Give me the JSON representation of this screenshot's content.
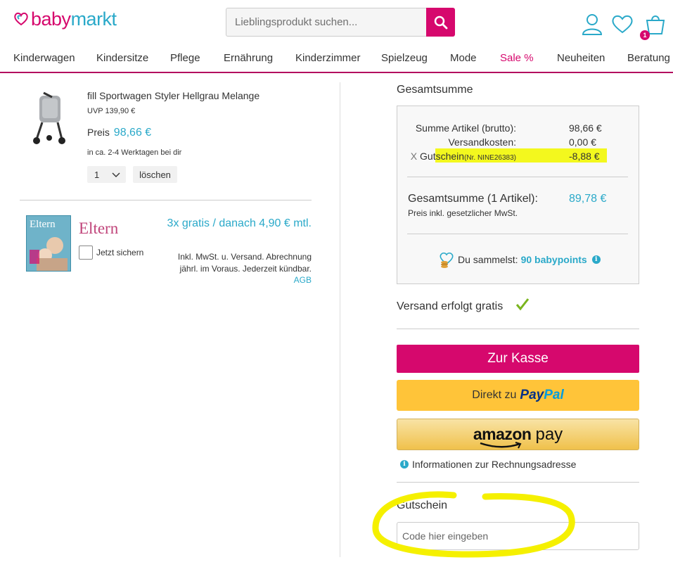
{
  "header": {
    "logo": {
      "part1": "baby",
      "part2": "markt"
    },
    "search_placeholder": "Lieblingsprodukt suchen...",
    "cart_count": "1"
  },
  "nav": [
    {
      "label": "Kinderwagen"
    },
    {
      "label": "Kindersitze"
    },
    {
      "label": "Pflege"
    },
    {
      "label": "Ernährung"
    },
    {
      "label": "Kinderzimmer"
    },
    {
      "label": "Spielzeug"
    },
    {
      "label": "Mode"
    },
    {
      "label": "Sale %"
    },
    {
      "label": "Neuheiten"
    },
    {
      "label": "Beratung"
    }
  ],
  "product": {
    "name": "fill Sportwagen Styler Hellgrau Melange",
    "uvp": "UVP 139,90 €",
    "price_label": "Preis",
    "price": "98,66 €",
    "delivery": "in ca. 2-4 Werktagen bei dir",
    "quantity": "1",
    "delete_label": "löschen"
  },
  "magazine": {
    "cover_title": "Eltern",
    "title": "Eltern",
    "checkbox_label": "Jetzt sichern",
    "offer": "3x gratis / danach 4,90 € mtl.",
    "fine_print": "Inkl. MwSt. u. Versand. Abrechnung jährl. im Voraus. Jederzeit kündbar.",
    "agb": "AGB"
  },
  "summary": {
    "title": "Gesamtsumme",
    "rows": [
      {
        "label": "Summe Artikel (brutto):",
        "value": "98,66 €"
      },
      {
        "label": "Versandkosten:",
        "value": "0,00 €"
      }
    ],
    "voucher": {
      "remove": "X",
      "label": "Gutschein",
      "code": "(Nr. NINE26383)",
      "value": "-8,88 €"
    },
    "total_label": "Gesamtsumme (1 Artikel):",
    "total_value": "89,78 €",
    "vat_note": "Preis inkl. gesetzlicher MwSt.",
    "points_text": "Du sammelst:",
    "points_value": "90 babypoints"
  },
  "shipping_text": "Versand erfolgt gratis",
  "checkout_label": "Zur Kasse",
  "paypal": {
    "prefix": "Direkt zu",
    "brand1": "Pay",
    "brand2": "Pal"
  },
  "amazon": {
    "brand": "amazon",
    "pay": "pay"
  },
  "billing_info": "Informationen zur Rechnungsadresse",
  "voucher_section": {
    "title": "Gutschein",
    "placeholder": "Code hier eingeben"
  },
  "colors": {
    "brand_pink": "#d6086d",
    "brand_teal": "#2aa9c9",
    "highlight": "#f3f81e",
    "paypal_yellow": "#ffc439"
  }
}
